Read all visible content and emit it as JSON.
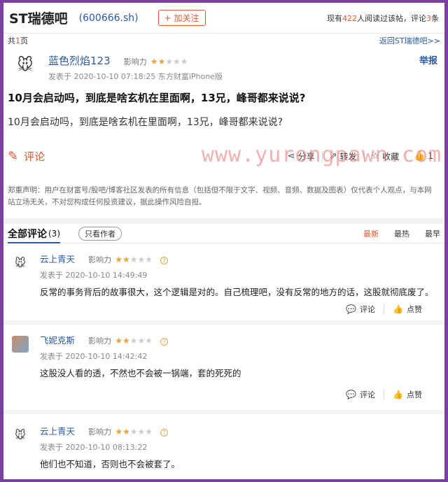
{
  "header": {
    "forum_title": "ST瑞德吧",
    "stock_code": "(600666.sh)",
    "follow_label": "+ 加关注",
    "readers_prefix": "现有",
    "readers_count": "422",
    "readers_suffix": "人阅读过该帖，评论",
    "comments_count": "3",
    "comments_suffix": "条"
  },
  "pagination": {
    "prefix": "共",
    "count": "1",
    "suffix": "页",
    "back_link": "返回ST瑞德吧>>"
  },
  "post": {
    "author": "蓝色烈焰123",
    "influence_label": "影响力",
    "stars_on": "★★",
    "stars_off": "★★★",
    "meta": "发表于  2020-10-10 07:18:25  东方财富iPhone版",
    "report": "举报",
    "title": "10月会启动吗，到底是啥玄机在里面啊，13兄，峰哥都来说说?",
    "body": "10月会启动吗，到底是啥玄机在里面啊，13兄，峰哥都来说说?",
    "watermark": "www.yurongpawn.com",
    "comment_label": "评论",
    "share_label": "分享",
    "repost_label": "转发",
    "favorite_label": "收藏",
    "like_count": "1"
  },
  "disclaimer": "郑重声明：用户在财富号/股吧/博客社区发表的所有信息（包括但不限于文字、视频、音频、数据及图表）仅代表个人观点，与本网站立场无关，不对您构成任何投资建议，据此操作风险自担。",
  "comments_section": {
    "title": "全部评论",
    "count": "(3)",
    "author_only": "只看作者",
    "sort_newest": "最新",
    "sort_hottest": "最热",
    "sort_oldest": "最早"
  },
  "comments": [
    {
      "author": "云上青天",
      "influence_label": "影响力",
      "stars_on": "★★",
      "stars_off": "★★★",
      "meta": "发表于  2020-10-10 14:49:49",
      "body": "反常的事务背后的故事很大，这个逻辑是对的。自己梳理吧，没有反常的地方的话，这股就彻底废了。",
      "reply_label": "评论",
      "like_label": "点赞"
    },
    {
      "author": "飞妮克斯",
      "influence_label": "影响力",
      "stars_on": "★★",
      "stars_off": "★★★",
      "meta": "发表于  2020-10-10 14:42:42",
      "body": "这股没人看的透，不然也不会被一锅端，套的死死的",
      "reply_label": "评论",
      "like_label": "点赞"
    },
    {
      "author": "云上青天",
      "influence_label": "影响力",
      "stars_on": "★★",
      "stars_off": "★★★",
      "meta": "发表于  2020-10-10 08:13:22",
      "body": "他们也不知道，否则也不会被套了。"
    }
  ]
}
